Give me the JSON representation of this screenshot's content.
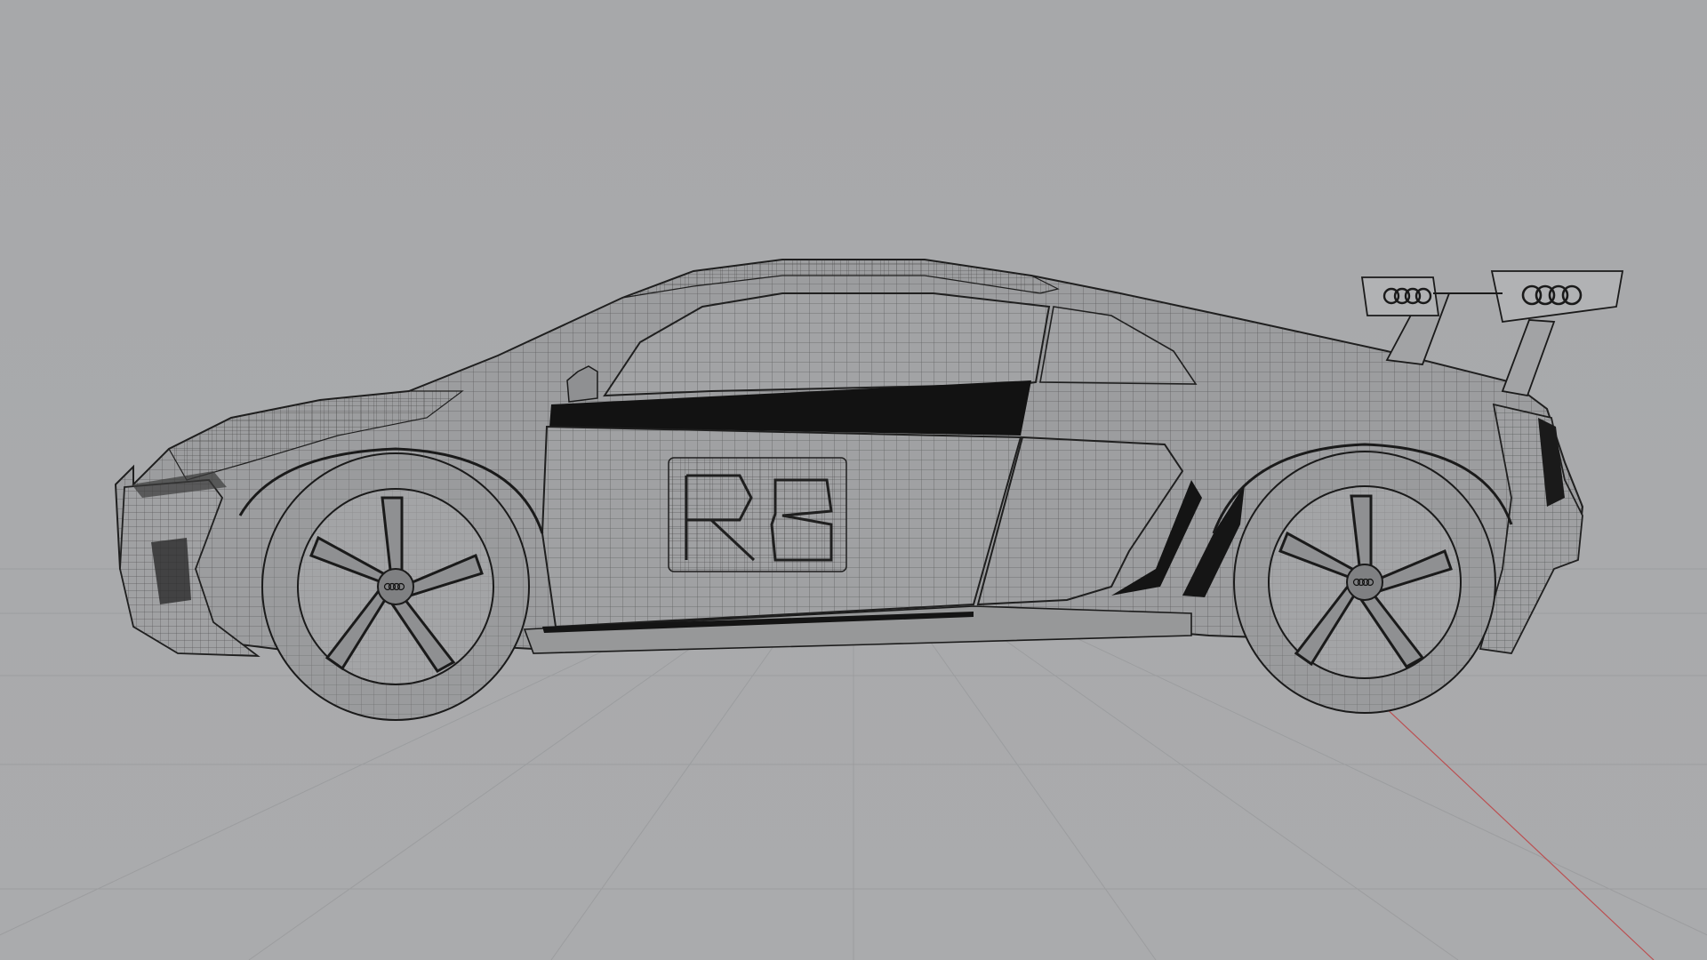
{
  "viewport": {
    "projection": "perspective",
    "shading": "wireframe",
    "view": "side",
    "grid_floor": true,
    "background_color": "#a8a9ab",
    "wire_color": "#2b2b2b",
    "floor_grid_color": "#9fa0a2",
    "x_axis_color": "#c0393b"
  },
  "scene": {
    "object_icon": "sports-car-model",
    "wheel_emblem_icon": "four-rings-logo",
    "wing_emblem_icon": "four-rings-logo",
    "door_decal_icon": "r8-lettering-decal"
  }
}
